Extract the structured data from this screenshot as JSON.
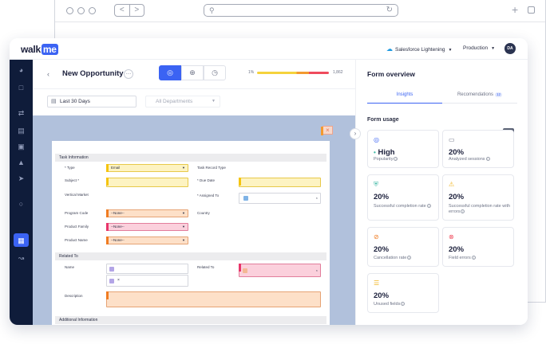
{
  "app": {
    "logo_text": "walk",
    "logo_me": "me",
    "system": "Salesforce Lightening",
    "environment": "Production",
    "avatar_initials": "DA"
  },
  "editor": {
    "back_icon": "chevron-left-icon",
    "title": "New Opportunity",
    "more_label": "…",
    "modes": [
      "eye-icon",
      "plus-icon",
      "clock-icon"
    ],
    "progress_left": "1%",
    "progress_right": "1,862",
    "date_filter": "Last 30 Days",
    "department_filter": "All Departments"
  },
  "form": {
    "sections": [
      "Task Information",
      "Related To",
      "Additional Information"
    ],
    "fields": {
      "type_label": "* Type",
      "type_value": "Email",
      "task_record_type_label": "Task Record Type",
      "subject_label": "Subject *",
      "due_date_label": "* Due Date",
      "vertical_market_label": "Vertical Market",
      "assigned_to_label": "* Assigned To",
      "assigned_clear": "×",
      "program_code_label": "Program Code",
      "program_code_value": "--None--",
      "country_label": "Country",
      "product_family_label": "Product Family",
      "product_family_value": "--None--",
      "product_name_label": "Product Name",
      "product_name_value": "--None--",
      "name_label": "Name",
      "name_clear": "×",
      "related_to_label": "Related To",
      "related_clear": "×",
      "description_label": "Description"
    },
    "close_label": "×"
  },
  "panel": {
    "title": "Form overview",
    "tabs": [
      {
        "label": "Insights"
      },
      {
        "label": "Recomendations",
        "badge": "12"
      }
    ],
    "section_title": "Form usage",
    "code_label": "<D>",
    "cards": [
      {
        "icon": "eye-icon",
        "value": "High",
        "label": "Popularity",
        "color": "#3fb8a5",
        "value_prefix": "•"
      },
      {
        "icon": "monitor-icon",
        "value": "20%",
        "label": "Analyzed sessions",
        "color": "#6d7386"
      },
      {
        "icon": "shield-check-icon",
        "value": "20%",
        "label": "Successful completion rate",
        "color": "#3fb8a5"
      },
      {
        "icon": "shield-warning-icon",
        "value": "20%",
        "label": "Successful completion rate with errors",
        "color": "#f0b522"
      },
      {
        "icon": "cancel-icon",
        "value": "20%",
        "label": "Cancellation rate",
        "color": "#f07c22"
      },
      {
        "icon": "error-icon",
        "value": "20%",
        "label": "Field errors",
        "color": "#ef4b5d"
      },
      {
        "icon": "layers-icon",
        "value": "20%",
        "label": "Unused fields",
        "color": "#f0b522"
      }
    ]
  },
  "browser": {
    "back_label": "<",
    "forward_label": ">",
    "plus_label": "+"
  }
}
